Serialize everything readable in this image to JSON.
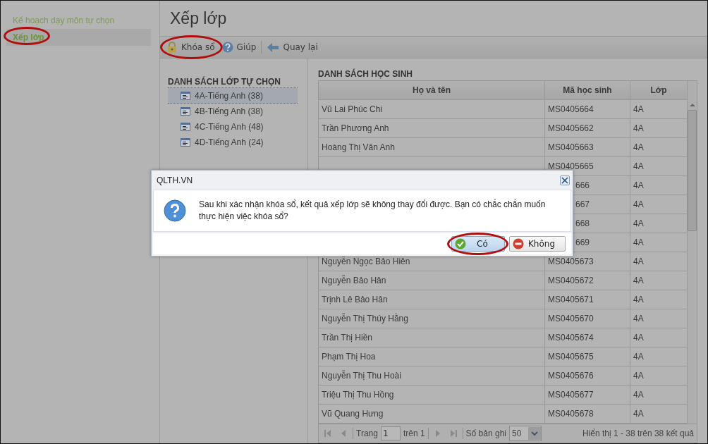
{
  "sidebar": {
    "items": [
      {
        "label": "Kế hoạch dạy môn tự chọn",
        "selected": false,
        "circled": false
      },
      {
        "label": "Xếp lớp",
        "selected": true,
        "circled": true
      }
    ]
  },
  "page_title": "Xếp lớp",
  "toolbar": {
    "buttons": [
      {
        "kind": "lock",
        "label": "Khóa sổ",
        "circled": true
      },
      {
        "kind": "help",
        "label": "Giúp",
        "circled": false
      },
      {
        "kind": "back",
        "label": "Quay lại",
        "circled": false
      }
    ]
  },
  "class_list": {
    "heading": "DANH SÁCH LỚP TỰ CHỌN",
    "items": [
      {
        "label": "4A-Tiếng Anh (38)",
        "selected": true
      },
      {
        "label": "4B-Tiếng Anh (38)",
        "selected": false
      },
      {
        "label": "4C-Tiếng Anh (48)",
        "selected": false
      },
      {
        "label": "4D-Tiếng Anh (24)",
        "selected": false
      }
    ]
  },
  "students": {
    "heading": "DANH SÁCH HỌC SINH",
    "columns": [
      "Họ và tên",
      "Mã học sinh",
      "Lớp"
    ],
    "rows": [
      {
        "name": "Vũ Lai Phúc Chi",
        "code": "MS0405664",
        "class": "4A"
      },
      {
        "name": "Trần Phương Anh",
        "code": "MS0405662",
        "class": "4A"
      },
      {
        "name": "Hoàng Thị Vân Anh",
        "code": "MS0405663",
        "class": "4A"
      },
      {
        "code": "MS0405665",
        "class": "4A"
      },
      {
        "code": "666",
        "code_partial": true,
        "class": "4A"
      },
      {
        "code": "667",
        "code_partial": true,
        "class": "4A"
      },
      {
        "code": "668",
        "code_partial": true,
        "class": "4A"
      },
      {
        "code": "669",
        "code_partial": true,
        "class": "4A"
      },
      {
        "name": "Nguyễn Ngọc Bảo Hiên",
        "code": "MS0405673",
        "class": "4A"
      },
      {
        "name": "Nguyễn Bảo Hân",
        "code": "MS0405672",
        "class": "4A"
      },
      {
        "name": "Trịnh Lê Bảo Hân",
        "code": "MS0405671",
        "class": "4A"
      },
      {
        "name": "Nguyễn Thị Thúy Hằng",
        "code": "MS0405670",
        "class": "4A"
      },
      {
        "name": "Trần Thị Hiền",
        "code": "MS0405674",
        "class": "4A"
      },
      {
        "name": "Phạm Thị Hoa",
        "code": "MS0405675",
        "class": "4A"
      },
      {
        "name": "Nguyễn Thị Thu Hoài",
        "code": "MS0405676",
        "class": "4A"
      },
      {
        "name": "Triệu Thị Thu Hồng",
        "code": "MS0405677",
        "class": "4A"
      },
      {
        "name": "Vũ Quang Hưng",
        "code": "MS0405678",
        "class": "4A"
      }
    ],
    "pager": {
      "page_label": "Trang",
      "page": "1",
      "of_label": "trên 1",
      "size_label": "Số bản ghi",
      "size": "50",
      "summary": "Hiển thị 1 - 38 trên 38 kết quả"
    }
  },
  "dialog": {
    "title": "QLTH.VN",
    "message": "Sau khi xác nhận khóa sổ, kết quả xếp lớp sẽ không thay đổi được. Bạn có chắc chắn muốn thực hiện việc khóa sổ?",
    "buttons": [
      {
        "kind": "yes",
        "label": "Có",
        "circled": true
      },
      {
        "kind": "no",
        "label": "Không",
        "circled": false
      }
    ]
  }
}
